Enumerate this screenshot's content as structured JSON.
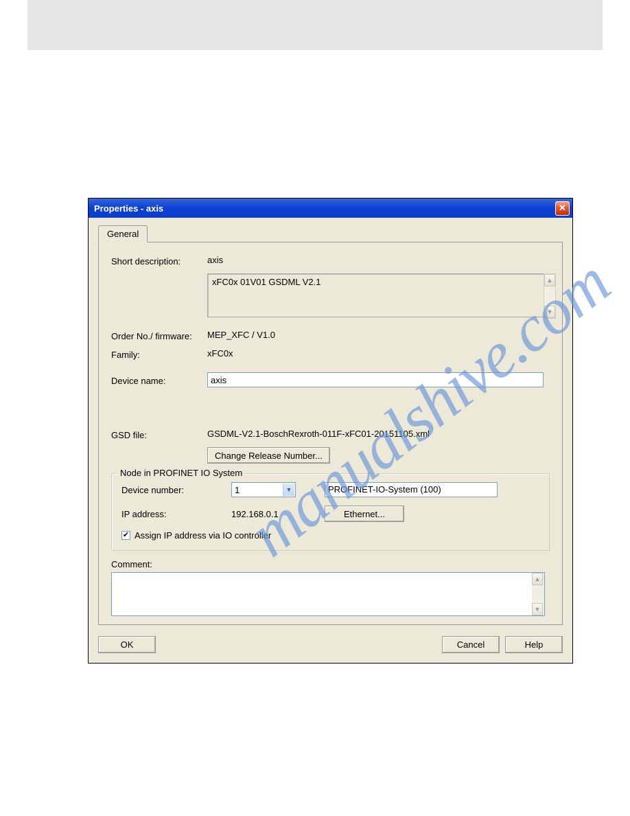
{
  "watermark": "manualshive.com",
  "dialog": {
    "title": "Properties - axis",
    "tab_label": "General",
    "short_description_label": "Short description:",
    "short_description_value": "axis",
    "details_text": "xFC0x 01V01 GSDML V2.1",
    "order_label": "Order No./ firmware:",
    "order_value": "MEP_XFC / V1.0",
    "family_label": "Family:",
    "family_value": "xFC0x",
    "device_name_label": "Device name:",
    "device_name_value": "axis",
    "gsd_label": "GSD file:",
    "gsd_value": "GSDML-V2.1-BoschRexroth-011F-xFC01-20151105.xml",
    "change_release_btn": "Change Release Number...",
    "node_group": {
      "legend": "Node in PROFINET IO System",
      "device_number_label": "Device number:",
      "device_number_value": "1",
      "system_name": "PROFINET-IO-System (100)",
      "ip_label": "IP address:",
      "ip_value": "192.168.0.1",
      "ethernet_btn": "Ethernet...",
      "assign_checkbox_label": "Assign IP address via IO controller"
    },
    "comment_label": "Comment:",
    "ok_btn": "OK",
    "cancel_btn": "Cancel",
    "help_btn": "Help"
  }
}
